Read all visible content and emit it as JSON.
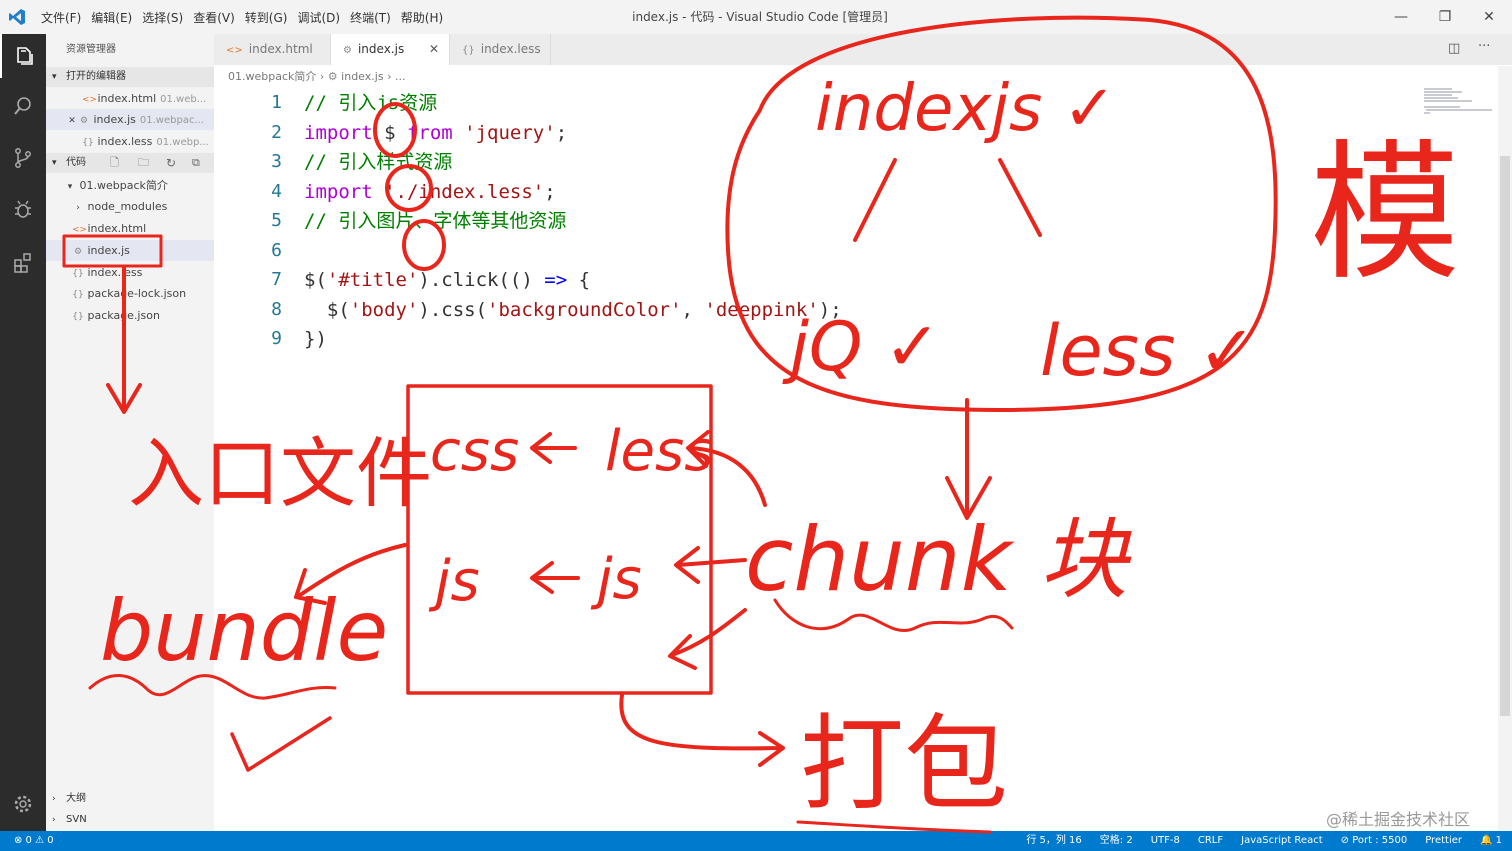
{
  "window": {
    "title": "index.js - 代码 - Visual Studio Code [管理员]",
    "minimize": "—",
    "restore": "❐",
    "close": "✕"
  },
  "menu": [
    "文件(F)",
    "编辑(E)",
    "选择(S)",
    "查看(V)",
    "转到(G)",
    "调试(D)",
    "终端(T)",
    "帮助(H)"
  ],
  "sidebar": {
    "title": "资源管理器",
    "open_editors": {
      "label": "打开的编辑器",
      "items": [
        {
          "name": "index.html",
          "sub": "01.web..."
        },
        {
          "name": "index.js",
          "sub": "01.webpac..."
        },
        {
          "name": "index.less",
          "sub": "01.webp..."
        }
      ]
    },
    "workspace": {
      "label": "代码",
      "folder": "01.webpack简介",
      "items": [
        "node_modules",
        "index.html",
        "index.js",
        "index.less",
        "package-lock.json",
        "package.json"
      ]
    },
    "outline": "大纲",
    "svn": "SVN"
  },
  "tabs": [
    {
      "label": "index.html",
      "icon": "html-icon"
    },
    {
      "label": "index.js",
      "icon": "gear-icon",
      "close": "✕"
    },
    {
      "label": "index.less",
      "icon": "braces-icon"
    }
  ],
  "breadcrumb": [
    "01.webpack简介",
    "index.js",
    "..."
  ],
  "code": {
    "line_numbers": [
      "1",
      "2",
      "3",
      "4",
      "5",
      "6",
      "7",
      "8",
      "9"
    ],
    "lines": [
      [
        {
          "t": "// 引入js资源",
          "c": "c-com"
        }
      ],
      [
        {
          "t": "import ",
          "c": "c-key"
        },
        {
          "t": "$ ",
          "c": "c-pun"
        },
        {
          "t": "from ",
          "c": "c-key"
        },
        {
          "t": "'jquery'",
          "c": "c-str"
        },
        {
          "t": ";",
          "c": "c-pun"
        }
      ],
      [
        {
          "t": "// 引入样式资源",
          "c": "c-com"
        }
      ],
      [
        {
          "t": "import ",
          "c": "c-key"
        },
        {
          "t": "'./index.less'",
          "c": "c-str"
        },
        {
          "t": ";",
          "c": "c-pun"
        }
      ],
      [
        {
          "t": "// 引入图片、字体等其他资源",
          "c": "c-com"
        }
      ],
      [],
      [
        {
          "t": "$(",
          "c": "c-pun"
        },
        {
          "t": "'#title'",
          "c": "c-str"
        },
        {
          "t": ").click(() ",
          "c": "c-pun"
        },
        {
          "t": "=>",
          "c": "c-kw"
        },
        {
          "t": " {",
          "c": "c-pun"
        }
      ],
      [
        {
          "t": "  $(",
          "c": "c-pun"
        },
        {
          "t": "'body'",
          "c": "c-str"
        },
        {
          "t": ").css(",
          "c": "c-pun"
        },
        {
          "t": "'backgroundColor'",
          "c": "c-str"
        },
        {
          "t": ", ",
          "c": "c-pun"
        },
        {
          "t": "'deeppink'",
          "c": "c-str"
        },
        {
          "t": ");",
          "c": "c-pun"
        }
      ],
      [
        {
          "t": "})",
          "c": "c-pun"
        }
      ]
    ]
  },
  "status": {
    "errors": "⊗ 0 ⚠ 0",
    "position": "行 5，列 16",
    "spaces": "空格: 2",
    "encoding": "UTF-8",
    "eol": "CRLF",
    "language": "JavaScript React",
    "port": "⊘ Port : 5500",
    "formatter": "Prettier",
    "notifications": "🔔 1"
  },
  "watermark": "@稀土掘金技术社区",
  "annotations": {
    "color": "#e8261c",
    "top_circle_text": "indexjs ✓",
    "jq": "jQ ✓",
    "less": "less ✓",
    "module": "模",
    "entry": "入口文件",
    "bundle": "bundle",
    "box_row1_left": "css",
    "box_row1_right": "less",
    "box_row2_left": "js",
    "box_row2_right": "js",
    "chunk": "chunk 块",
    "pack": "打包"
  }
}
